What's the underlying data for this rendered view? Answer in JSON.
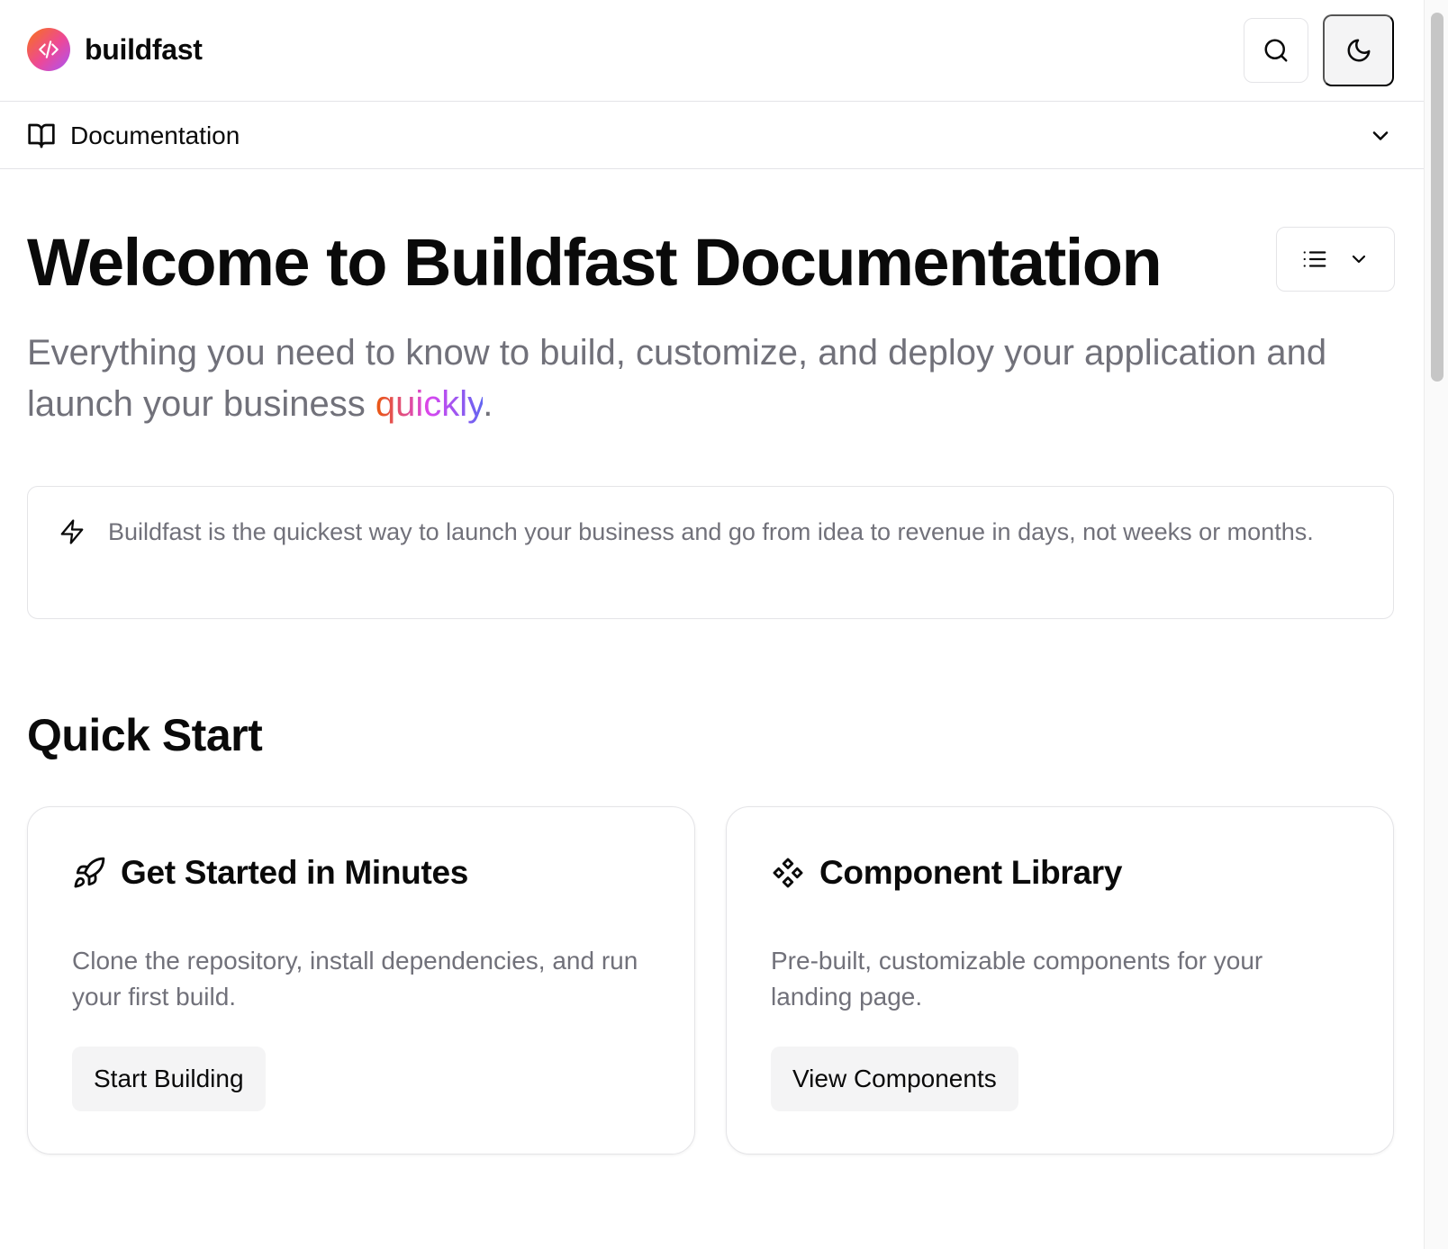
{
  "header": {
    "brand_name": "buildfast",
    "logo_icon": "code-icon",
    "search_icon": "search-icon",
    "theme_icon": "moon-icon"
  },
  "docnav": {
    "label": "Documentation",
    "icon": "book-open-icon",
    "chevron": "chevron-down-icon"
  },
  "main": {
    "title": "Welcome to Buildfast Documentation",
    "lead_before": "Everything you need to know to build, customize, and deploy your application and launch your business ",
    "lead_highlight": "quickly",
    "lead_after": ".",
    "callout": {
      "icon": "zap-icon",
      "text": "Buildfast is the quickest way to launch your business and go from idea to revenue in days, not weeks or months."
    },
    "section_title": "Quick Start",
    "cards": [
      {
        "icon": "rocket-icon",
        "title": "Get Started in Minutes",
        "description": "Clone the repository, install dependencies, and run your first build.",
        "button": "Start Building"
      },
      {
        "icon": "component-icon",
        "title": "Component Library",
        "description": "Pre-built, customizable components for your landing page.",
        "button": "View Components"
      }
    ]
  },
  "colors": {
    "accent_gradient": [
      "#ea580c",
      "#d946ef",
      "#6366f1"
    ],
    "muted_text": "#71717a",
    "border": "#e4e4e7"
  }
}
